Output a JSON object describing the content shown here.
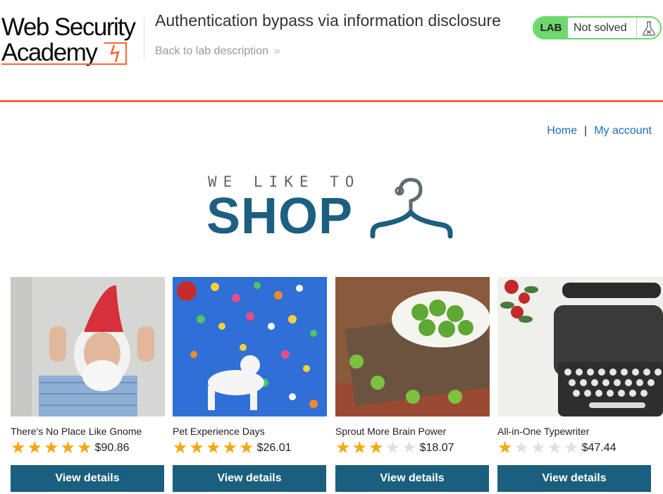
{
  "header": {
    "logo_line1": "Web Security",
    "logo_line2": "Academy",
    "lab_title": "Authentication bypass via information disclosure",
    "back_link": "Back to lab description",
    "back_chevron": "»",
    "lab_badge": "LAB",
    "lab_status": "Not solved",
    "accent_color": "#ff6633"
  },
  "nav": {
    "home": "Home",
    "separator": "|",
    "account": "My account"
  },
  "banner": {
    "tagline": "WE LIKE TO",
    "title": "SHOP"
  },
  "products": [
    {
      "name": "There's No Place Like Gnome",
      "rating": 5,
      "price": "$90.86",
      "button": "View details",
      "image_icon": "gnome-photo"
    },
    {
      "name": "Pet Experience Days",
      "rating": 5,
      "price": "$26.01",
      "button": "View details",
      "image_icon": "dog-balloons-photo"
    },
    {
      "name": "Sprout More Brain Power",
      "rating": 3,
      "price": "$18.07",
      "button": "View details",
      "image_icon": "sprouts-photo"
    },
    {
      "name": "All-in-One Typewriter",
      "rating": 1,
      "price": "$47.44",
      "button": "View details",
      "image_icon": "typewriter-photo"
    }
  ],
  "colors": {
    "button": "#1b5f7f",
    "star_on": "#f5a70d",
    "star_off": "#e0e0e0",
    "link": "#1a6fb8",
    "shop_blue": "#1c5f80",
    "lab_green": "#70d770"
  }
}
